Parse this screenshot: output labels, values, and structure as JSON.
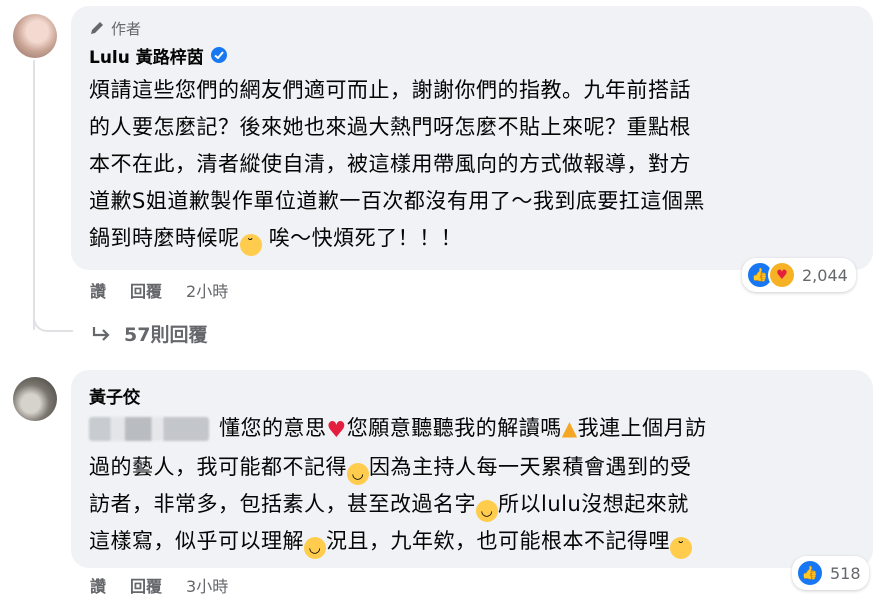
{
  "comment1": {
    "author_tag": "作者",
    "author_name": "Lulu 黃路梓茵",
    "verified": true,
    "lines": [
      "煩請這些您們的網友們適可而止，謝謝你們的指教。九年前搭話",
      "的人要怎麼記？後來她也來過大熱門呀怎麼不貼上來呢？重點根",
      "本不在此，清者縱使自清，被這樣用帶風向的方式做報導，對方",
      "道歉S姐道歉製作單位道歉一百次都沒有用了～我到底要扛這個黑",
      "鍋到時麼時候呢"
    ],
    "line5_tail": "唉～快煩死了！！！",
    "actions": {
      "like": "讚",
      "reply": "回覆",
      "time": "2小時"
    },
    "reaction_count": "2,044",
    "replies": "57則回覆"
  },
  "comment2": {
    "author_name": "黃子佼",
    "line1": "懂您的意思",
    "line1b": "您願意聽聽我的解讀嗎",
    "line1c": "我連上個月訪",
    "line2": "過的藝人，我可能都不記得",
    "line2b": "因為主持人每一天累積會遇到的受",
    "line3": "訪者，非常多，包括素人，甚至改過名字",
    "line3b": "所以lulu沒想起來就",
    "line4": "這樣寫，似乎可以理解",
    "line4b": "況且，九年欸，也可能根本不記得哩",
    "actions": {
      "like": "讚",
      "reply": "回覆",
      "time": "3小時"
    },
    "reaction_count": "518"
  },
  "icons": [
    "pencil-icon",
    "verified-badge-icon",
    "like-reaction-icon",
    "care-reaction-icon",
    "reply-arrow-icon",
    "heart-emoji",
    "pray-emoji",
    "laughing-emoji",
    "rofl-emoji",
    "smile-emoji",
    "pleading-emoji"
  ],
  "colors": {
    "bubble": "#f0f2f5",
    "meta_text": "#65676b",
    "like_blue": "#1877f2"
  }
}
